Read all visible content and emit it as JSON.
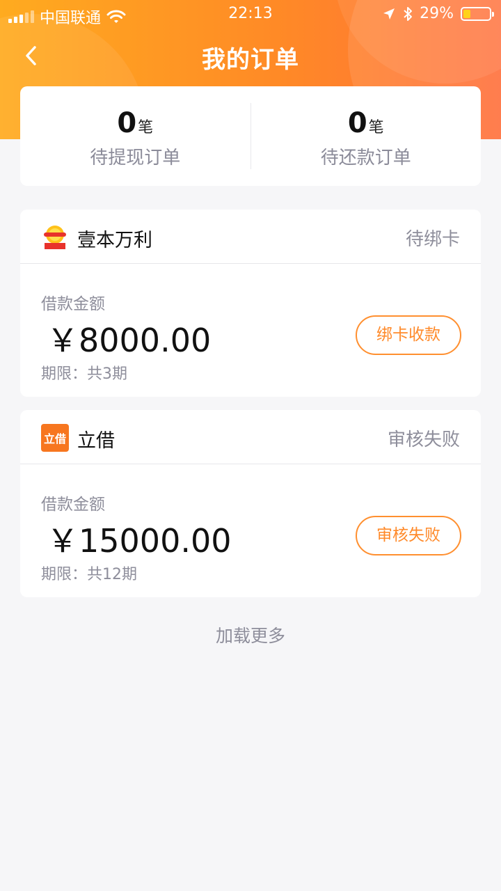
{
  "status_bar": {
    "carrier": "中国联通",
    "time": "22:13",
    "battery": "29%",
    "battery_level": 0.29
  },
  "nav": {
    "title": "我的订单"
  },
  "summary": {
    "unit": "笔",
    "items": [
      {
        "count": "0",
        "label": "待提现订单"
      },
      {
        "count": "0",
        "label": "待还款订单"
      }
    ]
  },
  "orders": [
    {
      "brand": "壹本万利",
      "state": "待绑卡",
      "amount_label": "借款金额",
      "amount": "￥8000.00",
      "term": "期限：共3期",
      "action": "绑卡收款"
    },
    {
      "brand": "立借",
      "state": "审核失败",
      "amount_label": "借款金额",
      "amount": "￥15000.00",
      "term": "期限：共12期",
      "action": "审核失败",
      "logo_text": "立借"
    }
  ],
  "load_more": "加载更多",
  "colors": {
    "accent": "#ff8a26",
    "header_start": "#ffab1f",
    "header_end": "#ff6f3a",
    "muted_text": "#8e8e9b",
    "background": "#f6f6f8"
  },
  "icons": {
    "back": "chevron-left-icon",
    "wifi": "wifi-icon",
    "location": "location-arrow-icon",
    "bluetooth": "bluetooth-icon",
    "battery": "battery-icon"
  }
}
